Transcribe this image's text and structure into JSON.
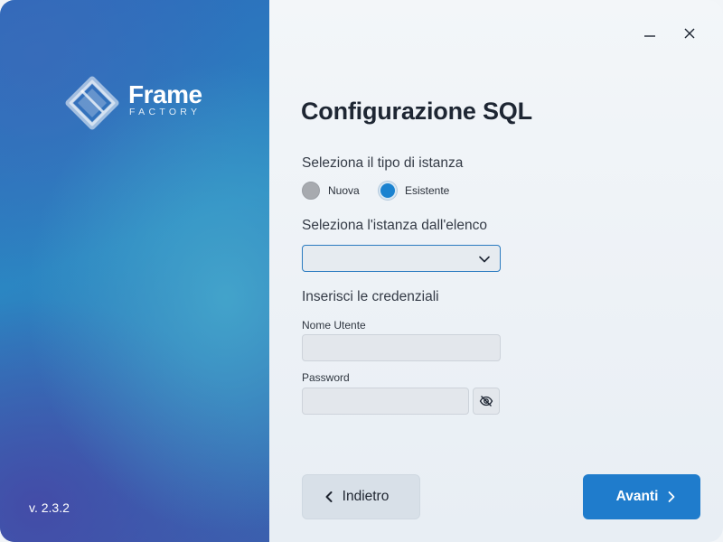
{
  "app": {
    "logo_word": "Frame",
    "logo_sub": "FACTORY",
    "version": "v. 2.3.2"
  },
  "window_controls": {
    "minimize_icon": "minimize-icon",
    "close_icon": "close-icon"
  },
  "page": {
    "title": "Configurazione SQL"
  },
  "instance_type": {
    "label": "Seleziona il tipo di istanza",
    "options": [
      {
        "label": "Nuova",
        "selected": false
      },
      {
        "label": "Esistente",
        "selected": true
      }
    ]
  },
  "instance_select": {
    "label": "Seleziona l'istanza dall'elenco",
    "value": ""
  },
  "credentials": {
    "label": "Inserisci le credenziali",
    "username_label": "Nome Utente",
    "username_value": "",
    "password_label": "Password",
    "password_value": "",
    "toggle_icon": "eye-slash-icon"
  },
  "footer": {
    "back_label": "Indietro",
    "next_label": "Avanti"
  },
  "colors": {
    "accent": "#1f7ccc",
    "brand_panel": "#2b86c2",
    "radio_selected": "#1a82d0",
    "radio_unselected": "#a7aaaf"
  }
}
